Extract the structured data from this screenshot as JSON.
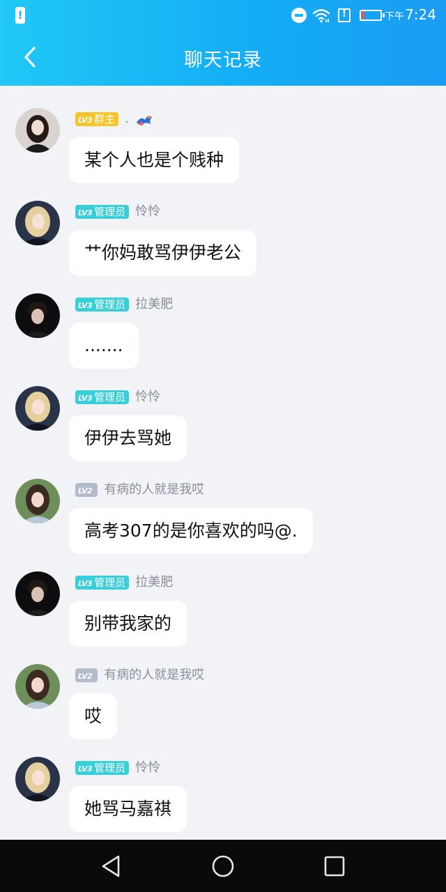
{
  "status_bar": {
    "time_prefix": "下午",
    "time": "7:24"
  },
  "header": {
    "title": "聊天记录"
  },
  "colors": {
    "header_start": "#21c8f6",
    "header_end": "#1a9cf4",
    "badge_owner": "#f5c52a",
    "badge_admin": "#38cfd8",
    "badge_member": "#b4bccb"
  },
  "messages": [
    {
      "level": "LV3",
      "role": "群主",
      "nickname": ".",
      "text": "某个人也是个贱种",
      "role_type": "owner"
    },
    {
      "level": "LV3",
      "role": "管理员",
      "nickname": "怜怜",
      "text": "艹你妈敢骂伊伊老公",
      "role_type": "admin"
    },
    {
      "level": "LV3",
      "role": "管理员",
      "nickname": "拉美肥",
      "text": ".......",
      "role_type": "admin"
    },
    {
      "level": "LV3",
      "role": "管理员",
      "nickname": "怜怜",
      "text": "伊伊去骂她",
      "role_type": "admin"
    },
    {
      "level": "LV2",
      "role": "",
      "nickname": "有病的人就是我哎",
      "text": "高考307的是你喜欢的吗@.",
      "role_type": "member"
    },
    {
      "level": "LV3",
      "role": "管理员",
      "nickname": "拉美肥",
      "text": "别带我家的",
      "role_type": "admin"
    },
    {
      "level": "LV2",
      "role": "",
      "nickname": "有病的人就是我哎",
      "text": "哎",
      "role_type": "member"
    },
    {
      "level": "LV3",
      "role": "管理员",
      "nickname": "怜怜",
      "text": "她骂马嘉祺",
      "role_type": "admin"
    }
  ]
}
